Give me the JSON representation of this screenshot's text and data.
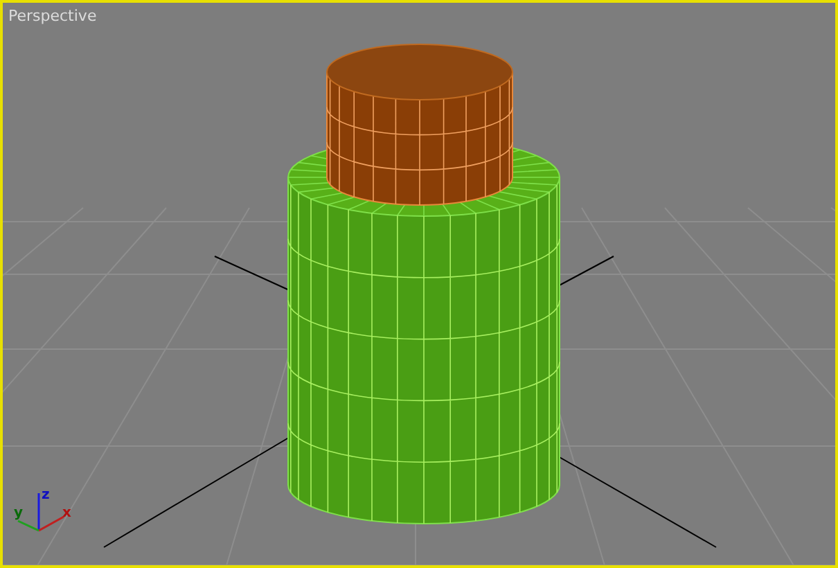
{
  "viewport": {
    "label": "Perspective",
    "active": true
  },
  "axis_gizmo": {
    "x_label": "x",
    "y_label": "y",
    "z_label": "z"
  }
}
